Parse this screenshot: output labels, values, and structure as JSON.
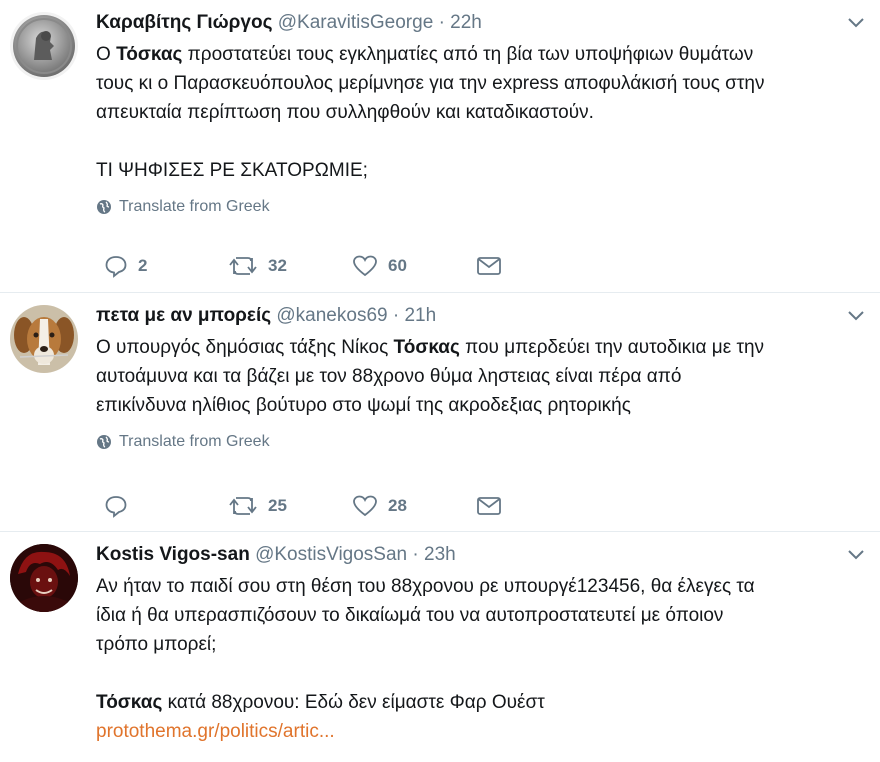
{
  "tweets": [
    {
      "name": "Καραβίτης Γιώργος",
      "handle": "@KaravitisGeorge",
      "sep": "·",
      "time": "22h",
      "lines": [
        [
          {
            "t": "Ο "
          },
          {
            "t": "Τόσκας",
            "b": true
          },
          {
            "t": " προστατεύει τους εγκληματίες από τη βία των υποψήφιων θυμάτων"
          }
        ],
        [
          {
            "t": "τους κι ο Παρασκευόπουλος μερίμνησε για την express αποφυλάκισή τους στην"
          }
        ],
        [
          {
            "t": "απευκταία περίπτωση που συλληφθούν και καταδικαστούν."
          }
        ],
        [],
        [
          {
            "t": "ΤΙ ΨΗΦΙΣΕΣ ΡΕ ΣΚΑΤΟΡΩΜΙΕ;"
          }
        ]
      ],
      "translate": "Translate from Greek",
      "replies": "2",
      "retweets": "32",
      "likes": "60"
    },
    {
      "name": "πετα με αν μπορείς",
      "handle": "@kanekos69",
      "sep": "·",
      "time": "21h",
      "lines": [
        [
          {
            "t": "Ο υπουργός δημόσιας τάξης Νίκος "
          },
          {
            "t": "Τόσκας",
            "b": true
          },
          {
            "t": " που μπερδεύει την αυτοδικια με την"
          }
        ],
        [
          {
            "t": "αυτοάμυνα και τα βάζει με τον 88χρονο θύμα ληστειας είναι πέρα από"
          }
        ],
        [
          {
            "t": "επικίνδυνα ηλίθιος βούτυρο στο ψωμί της ακροδεξιας ρητορικής"
          }
        ]
      ],
      "translate": "Translate from Greek",
      "replies": "",
      "retweets": "25",
      "likes": "28"
    },
    {
      "name": "Kostis Vigos-san",
      "handle": "@KostisVigosSan",
      "sep": "·",
      "time": "23h",
      "lines": [
        [
          {
            "t": "Αν ήταν το παιδί σου στη θέση του 88χρονου ρε υπουργέ123456, θα έλεγες τα"
          }
        ],
        [
          {
            "t": "ίδια ή θα υπερασπιζόσουν το δικαίωμά του να αυτοπροστατευτεί με όποιον"
          }
        ],
        [
          {
            "t": "τρόπο μπορεί;"
          }
        ],
        [],
        [
          {
            "t": "Τόσκας",
            "b": true
          },
          {
            "t": " κατά 88χρονου: Εδώ δεν είμαστε Φαρ Ουέστ"
          }
        ],
        [
          {
            "t": "protothema.gr/politics/artic...",
            "link": true
          }
        ]
      ]
    }
  ]
}
